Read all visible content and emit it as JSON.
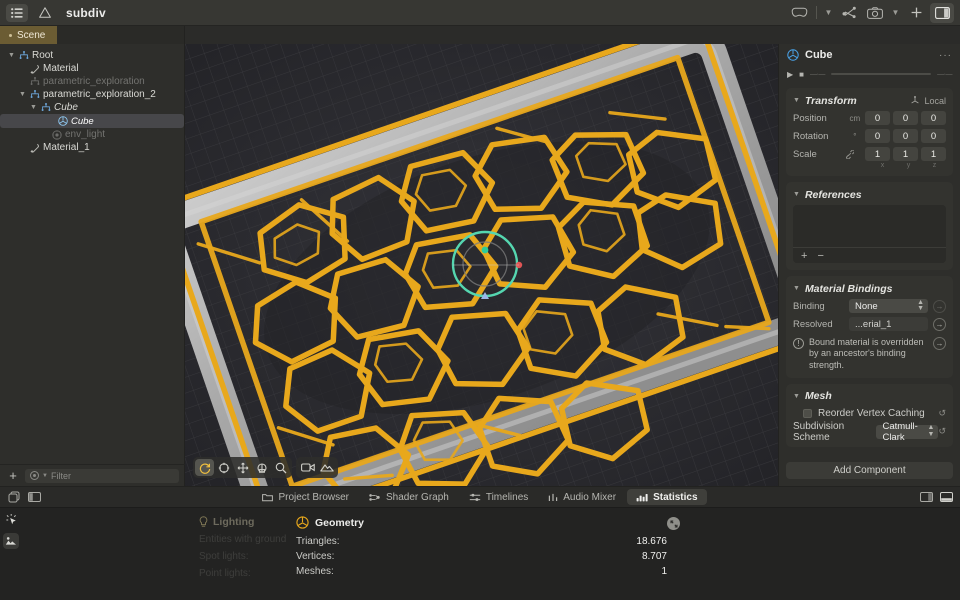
{
  "app": {
    "title": "subdiv",
    "accent_yellow": "#E8A81C",
    "accent_teal": "#55D6B0",
    "tab_olive": "#6b5c33"
  },
  "topbar": {
    "menu_icon": "list-icon",
    "warning_icon": "warning-triangle-icon",
    "title": "subdiv",
    "right_icons": [
      "headset-icon",
      "chevron-down-icon",
      "share-nodes-icon",
      "camera-icon",
      "chevron-down-icon",
      "plus-icon",
      "right-panel-icon"
    ]
  },
  "sidebar": {
    "scene_tab": "Scene",
    "tree": [
      {
        "label": "Root",
        "icon": "hierarchy-icon",
        "depth": 0,
        "twisty": "down",
        "state": "normal",
        "selected": false,
        "italic": false
      },
      {
        "label": "Material",
        "icon": "material-icon",
        "depth": 1,
        "twisty": "",
        "state": "normal",
        "selected": false,
        "italic": false
      },
      {
        "label": "parametric_exploration",
        "icon": "hierarchy-icon",
        "depth": 1,
        "twisty": "",
        "state": "disabled",
        "selected": false,
        "italic": false
      },
      {
        "label": "parametric_exploration_2",
        "icon": "hierarchy-icon",
        "depth": 1,
        "twisty": "down",
        "state": "normal",
        "selected": false,
        "italic": false
      },
      {
        "label": "Cube",
        "icon": "hierarchy-icon",
        "depth": 2,
        "twisty": "down",
        "state": "normal",
        "selected": false,
        "italic": true
      },
      {
        "label": "Cube",
        "icon": "mesh-icon",
        "depth": 3,
        "twisty": "",
        "state": "normal",
        "selected": true,
        "italic": true
      },
      {
        "label": "env_light",
        "icon": "light-icon",
        "depth": 3,
        "twisty": "",
        "state": "disabled",
        "selected": false,
        "italic": false
      },
      {
        "label": "Material_1",
        "icon": "material-icon",
        "depth": 1,
        "twisty": "",
        "state": "normal",
        "selected": false,
        "italic": false
      }
    ],
    "footer": {
      "add_label": "+",
      "filter_placeholder": "Filter",
      "filter_value": ""
    }
  },
  "viewport": {
    "toolbar_primary": [
      "orbit-icon",
      "target-icon",
      "move-icon",
      "scale-icon",
      "zoom-icon"
    ],
    "toolbar_secondary": [
      "camera-video-icon",
      "terrain-icon"
    ],
    "active_tool": "orbit-icon"
  },
  "inspector": {
    "header": {
      "icon": "mesh-icon",
      "title": "Cube",
      "menu": "···"
    },
    "playback": {
      "play": "play-icon",
      "stop": "stop-icon",
      "left_tick": "—·—",
      "right_tick": "—·—"
    },
    "transform": {
      "name": "Transform",
      "space_label": "Local",
      "space_icon": "axes-icon",
      "rows": [
        {
          "label": "Position",
          "unit": "cm",
          "values": [
            "0",
            "0",
            "0"
          ]
        },
        {
          "label": "Rotation",
          "unit": "°",
          "values": [
            "0",
            "0",
            "0"
          ]
        },
        {
          "label": "Scale",
          "unit": "link-icon",
          "values": [
            "1",
            "1",
            "1"
          ]
        }
      ],
      "axes": [
        "x",
        "y",
        "z"
      ]
    },
    "references": {
      "name": "References",
      "add": "+",
      "remove": "−",
      "items": []
    },
    "material_bindings": {
      "name": "Material Bindings",
      "binding_label": "Binding",
      "binding_value": "None",
      "resolved_label": "Resolved",
      "resolved_value": "...erial_1",
      "warning": "Bound material is overridden by an ancestor's binding strength."
    },
    "mesh": {
      "name": "Mesh",
      "reorder_label": "Reorder Vertex Caching",
      "reorder_checked": false,
      "scheme_label": "Subdivision Scheme",
      "scheme_value": "Catmull-Clark"
    },
    "add_component": "Add Component"
  },
  "panel_tabs": {
    "items": [
      {
        "label": "Project Browser",
        "icon": "folder-icon",
        "active": false
      },
      {
        "label": "Shader Graph",
        "icon": "nodes-icon",
        "active": false
      },
      {
        "label": "Timelines",
        "icon": "timeline-icon",
        "active": false
      },
      {
        "label": "Audio Mixer",
        "icon": "mixer-icon",
        "active": false
      },
      {
        "label": "Statistics",
        "icon": "bars-icon",
        "active": true
      }
    ],
    "left_icons": [
      "copy-panels-icon",
      "left-panel-icon"
    ],
    "right_icons": [
      "right-panel-icon",
      "bottom-panel-icon"
    ]
  },
  "bottom_panel": {
    "rail_icons": [
      "sparkle-cursor-icon",
      "layers-icon"
    ],
    "lighting": {
      "title": "Lighting",
      "icon": "bulb-icon",
      "rows": [
        {
          "label": "Entities with ground",
          "value": ""
        },
        {
          "label": "Spot lights:",
          "value": ""
        },
        {
          "label": "Point lights:",
          "value": ""
        }
      ]
    },
    "geometry": {
      "title": "Geometry",
      "icon": "geometry-icon",
      "close_icon": "collapse-icon",
      "rows": [
        {
          "label": "Triangles:",
          "value": "18.676"
        },
        {
          "label": "Vertices:",
          "value": "8.707"
        },
        {
          "label": "Meshes:",
          "value": "1"
        }
      ]
    }
  }
}
